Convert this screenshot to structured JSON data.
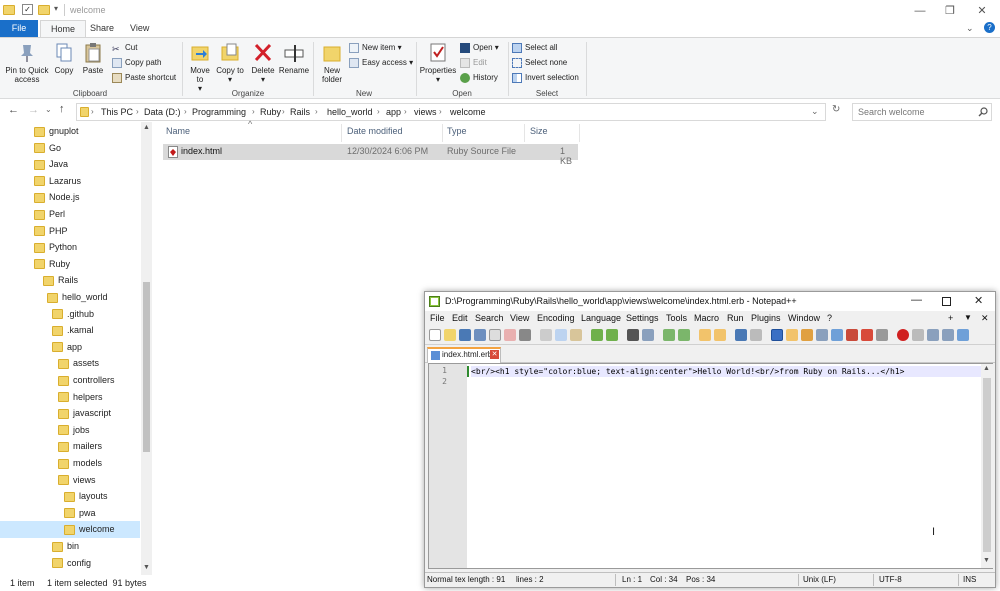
{
  "window": {
    "title": "welcome",
    "minimize": "—",
    "restore": "❐",
    "close": "✕"
  },
  "ribbon_tabs": [
    "File",
    "Home",
    "Share",
    "View"
  ],
  "ribbon": {
    "clipboard": {
      "label": "Clipboard",
      "pin": "Pin to Quick access",
      "copy": "Copy",
      "paste": "Paste",
      "cut": "Cut",
      "copy_path": "Copy path",
      "paste_shortcut": "Paste shortcut"
    },
    "organize": {
      "label": "Organize",
      "move_to": "Move to",
      "copy_to": "Copy to",
      "delete": "Delete",
      "rename": "Rename"
    },
    "new": {
      "label": "New",
      "new_folder": "New folder",
      "new_item": "New item",
      "easy_access": "Easy access"
    },
    "open": {
      "label": "Open",
      "properties": "Properties",
      "open": "Open",
      "edit": "Edit",
      "history": "History"
    },
    "select": {
      "label": "Select",
      "select_all": "Select all",
      "select_none": "Select none",
      "invert": "Invert selection"
    }
  },
  "address": {
    "crumbs": [
      "This PC",
      "Data (D:)",
      "Programming",
      "Ruby",
      "Rails",
      "hello_world",
      "app",
      "views",
      "welcome"
    ],
    "search_placeholder": "Search welcome"
  },
  "nav_tree": [
    {
      "label": "gnuplot",
      "depth": 0
    },
    {
      "label": "Go",
      "depth": 0
    },
    {
      "label": "Java",
      "depth": 0
    },
    {
      "label": "Lazarus",
      "depth": 0
    },
    {
      "label": "Node.js",
      "depth": 0
    },
    {
      "label": "Perl",
      "depth": 0
    },
    {
      "label": "PHP",
      "depth": 0
    },
    {
      "label": "Python",
      "depth": 0
    },
    {
      "label": "Ruby",
      "depth": 0
    },
    {
      "label": "Rails",
      "depth": 1
    },
    {
      "label": "hello_world",
      "depth": 2
    },
    {
      "label": ".github",
      "depth": 3
    },
    {
      "label": ".kamal",
      "depth": 3
    },
    {
      "label": "app",
      "depth": 3
    },
    {
      "label": "assets",
      "depth": 4
    },
    {
      "label": "controllers",
      "depth": 4
    },
    {
      "label": "helpers",
      "depth": 4
    },
    {
      "label": "javascript",
      "depth": 4
    },
    {
      "label": "jobs",
      "depth": 4
    },
    {
      "label": "mailers",
      "depth": 4
    },
    {
      "label": "models",
      "depth": 4
    },
    {
      "label": "views",
      "depth": 4
    },
    {
      "label": "layouts",
      "depth": 5
    },
    {
      "label": "pwa",
      "depth": 5
    },
    {
      "label": "welcome",
      "depth": 5,
      "selected": true
    },
    {
      "label": "bin",
      "depth": 3
    },
    {
      "label": "config",
      "depth": 3
    }
  ],
  "file_list": {
    "headers": {
      "name": "Name",
      "date": "Date modified",
      "type": "Type",
      "size": "Size"
    },
    "rows": [
      {
        "name": "index.html",
        "date": "12/30/2024 6:06 PM",
        "type": "Ruby Source File",
        "size": "1 KB"
      }
    ]
  },
  "status": {
    "count": "1 item",
    "selected": "1 item selected  91 bytes"
  },
  "npp": {
    "title": "D:\\Programming\\Ruby\\Rails\\hello_world\\app\\views\\welcome\\index.html.erb - Notepad++",
    "menu": [
      "File",
      "Edit",
      "Search",
      "View",
      "Encoding",
      "Language",
      "Settings",
      "Tools",
      "Macro",
      "Run",
      "Plugins",
      "Window",
      "?"
    ],
    "menu_right": [
      "+",
      "▼",
      "✕"
    ],
    "tab": "index.html.erb",
    "lines": [
      "1",
      "2"
    ],
    "code": "<br/><h1 style=\"color:blue; text-align:center\">Hello World!<br/>from Ruby on Rails...</h1>",
    "status": {
      "length": "Normal tex length : 91",
      "lines": "lines : 2",
      "ln": "Ln : 1",
      "col": "Col : 34",
      "pos": "Pos : 34",
      "eol": "Unix (LF)",
      "encoding": "UTF-8",
      "mode": "INS"
    }
  }
}
